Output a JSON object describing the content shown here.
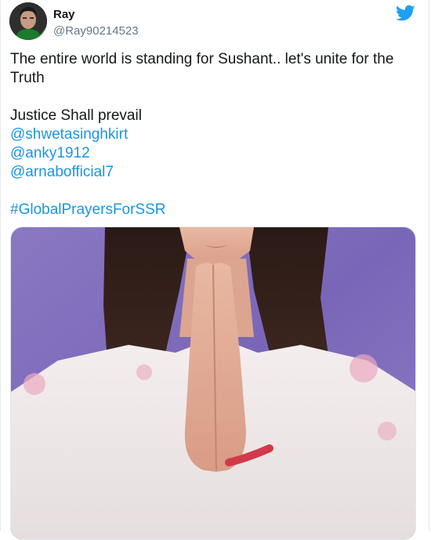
{
  "author": {
    "name": "Ray",
    "handle": "@Ray90214523"
  },
  "icons": {
    "logo": "twitter-bird-icon"
  },
  "colors": {
    "link": "#1b95e0",
    "text": "#14171a",
    "muted": "#657786",
    "brand": "#1da1f2"
  },
  "tweet": {
    "line1": "The entire world is standing for Sushant.. let's unite for the",
    "line2": "Truth",
    "line3": "Justice Shall prevail",
    "mentions": [
      "@shwetasinghkirt",
      "@anky1912",
      "@arnabofficial7"
    ],
    "hashtag": "#GlobalPrayersForSSR"
  }
}
